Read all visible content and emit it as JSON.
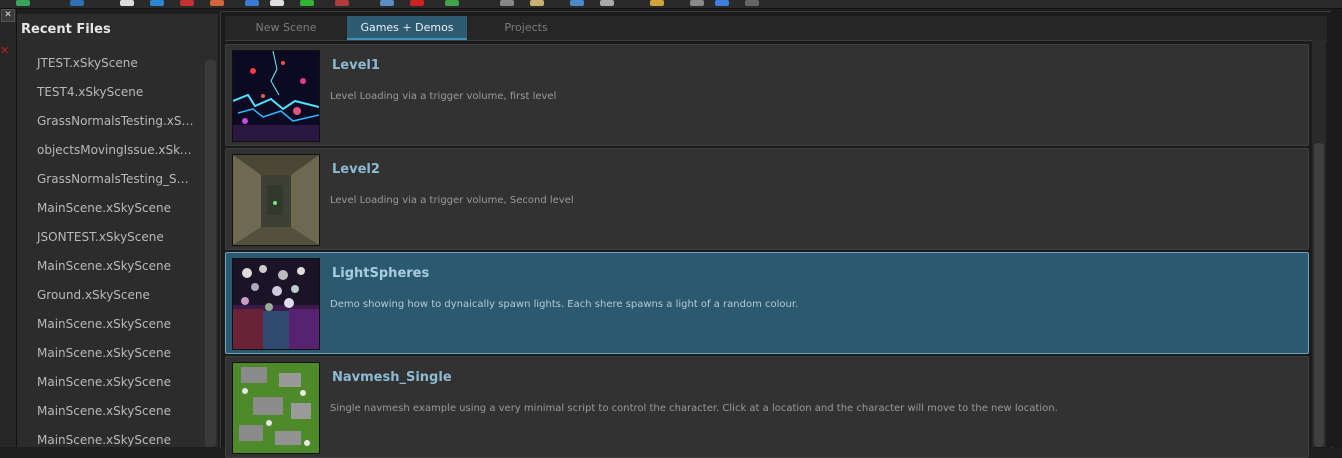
{
  "toolbar": {
    "icons": [
      {
        "name": "tool-green-icon",
        "color": "#3aa55a"
      },
      {
        "name": "tool-globe-icon",
        "color": "#2f6fb3"
      },
      {
        "name": "tool-gear-icon",
        "color": "#dddddd"
      },
      {
        "name": "tool-blue-icon",
        "color": "#2d86d1"
      },
      {
        "name": "tool-red-icon",
        "color": "#c43232"
      },
      {
        "name": "tool-color-wheel-icon",
        "color": "#d4643c"
      },
      {
        "name": "tool-cube-icon",
        "color": "#3b7bd6"
      },
      {
        "name": "tool-page-icon",
        "color": "#e0e0e0"
      },
      {
        "name": "tool-grid-icon",
        "color": "#33b533"
      },
      {
        "name": "tool-record-icon",
        "color": "#b33a3a"
      },
      {
        "name": "tool-monitor-icon",
        "color": "#5b8ec7"
      },
      {
        "name": "tool-flag-icon",
        "color": "#c22"
      },
      {
        "name": "tool-chart-icon",
        "color": "#3fa44a"
      },
      {
        "name": "tool-sphere-icon",
        "color": "#888"
      },
      {
        "name": "tool-book-icon",
        "color": "#c9b070"
      },
      {
        "name": "tool-window-icon",
        "color": "#4a8ac8"
      },
      {
        "name": "tool-brush-icon",
        "color": "#aaa"
      },
      {
        "name": "tool-pencil-icon",
        "color": "#d1a13a"
      },
      {
        "name": "tool-satellite-icon",
        "color": "#8a8a8a"
      },
      {
        "name": "tool-ball-icon",
        "color": "#3f7fe0"
      },
      {
        "name": "tool-camera-icon",
        "color": "#666"
      }
    ]
  },
  "gutter": {
    "close_glyph": "✕",
    "x_glyph": "✕"
  },
  "recent": {
    "title": "Recent Files",
    "items": [
      "JTEST.xSkyScene",
      "TEST4.xSkyScene",
      "GrassNormalsTesting.xSkyScene",
      "objectsMovingIssue.xSkyScene",
      "GrassNormalsTesting_SMALL.xSkyScene",
      "MainScene.xSkyScene",
      "JSONTEST.xSkyScene",
      "MainScene.xSkyScene",
      "Ground.xSkyScene",
      "MainScene.xSkyScene",
      "MainScene.xSkyScene",
      "MainScene.xSkyScene",
      "MainScene.xSkyScene",
      "MainScene.xSkyScene"
    ]
  },
  "tabs": [
    {
      "label": "New Scene",
      "active": false
    },
    {
      "label": "Games + Demos",
      "active": true
    },
    {
      "label": "Projects",
      "active": false
    }
  ],
  "cards": [
    {
      "title": "Level1",
      "description": "Level Loading via a trigger volume, first level",
      "selected": false,
      "thumb": "thumb-lightning"
    },
    {
      "title": "Level2",
      "description": "Level Loading via a trigger volume, Second level",
      "selected": false,
      "thumb": "thumb-stone-corridor"
    },
    {
      "title": "LightSpheres",
      "description": "Demo showing how to dynaically spawn lights. Each shere spawns a light of a random colour.",
      "selected": true,
      "thumb": "thumb-light-spheres"
    },
    {
      "title": "Navmesh_Single",
      "description": "Single navmesh example using a very minimal script to control the character. Click at a location and the character will move to the new location.",
      "selected": false,
      "thumb": "thumb-navmesh"
    }
  ]
}
